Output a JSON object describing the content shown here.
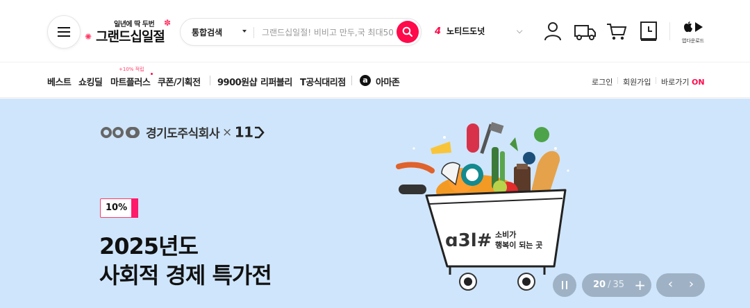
{
  "header": {
    "logo_sub": "일년에 딱 두번",
    "logo_main": "그랜드십일절",
    "search_category": "통합검색",
    "search_placeholder": "그랜드십일절! 비비고 만두,국 최대50",
    "rank_number": "4",
    "rank_keyword": "노티드도넛",
    "app_download_label": "앱다운로드"
  },
  "nav": {
    "items": [
      "베스트",
      "쇼킹딜",
      "마트플러스",
      "쿠폰/기획전",
      "9900원샵",
      "리퍼블리",
      "T공식대리점"
    ],
    "mart_badge": "+10% 적립",
    "amazon_icon_letter": "a",
    "amazon_label": "아마존",
    "util": {
      "login": "로그인",
      "signup": "회원가입",
      "shortcut": "바로가기",
      "shortcut_on": "ON"
    }
  },
  "banner": {
    "partner_name": "경기도주식회사",
    "partner_x": "×",
    "partner_11st": "11",
    "tag": "10%",
    "title_line1": "2025년도",
    "title_line2": "사회적 경제 특가전",
    "cart_logo_text": "ɑ3l#",
    "cart_caption_line1": "소비가",
    "cart_caption_line2": "행복이 되는 곳",
    "pager_current": "20",
    "pager_sep": "/",
    "pager_total": "35",
    "pager_plus": "+",
    "prev_arrow": "‹",
    "next_arrow": "›"
  },
  "colors": {
    "accent": "#ff0a4a",
    "banner_bg": "#cfe5fb",
    "control_bg": "#9fb2c5"
  }
}
